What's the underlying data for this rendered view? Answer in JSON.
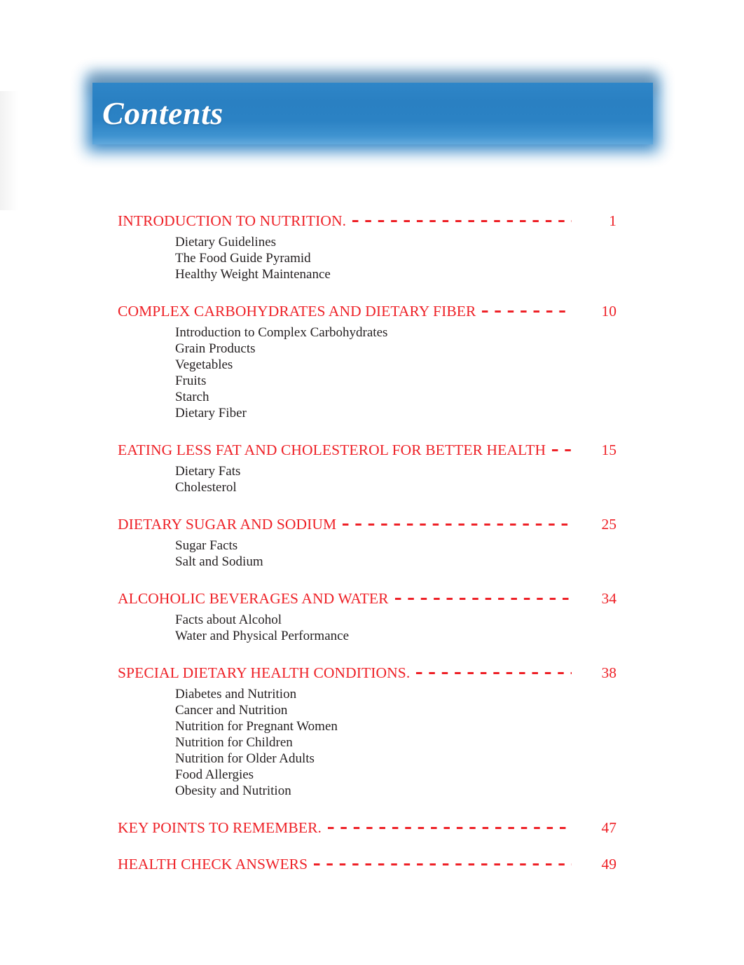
{
  "document": {
    "banner_title": "Contents",
    "banner_color": "#2a80c2",
    "heading_color": "#ee2026",
    "body_text_color": "#231f20"
  },
  "toc": {
    "entries": [
      {
        "title": "INTRODUCTION TO NUTRITION.",
        "page": "1",
        "subsections": [
          "Dietary Guidelines",
          "The Food Guide Pyramid",
          "Healthy Weight Maintenance"
        ]
      },
      {
        "title": "COMPLEX CARBOHYDRATES AND DIETARY FIBER",
        "page": "10",
        "subsections": [
          "Introduction to Complex Carbohydrates",
          "Grain Products",
          "Vegetables",
          "Fruits",
          "Starch",
          "Dietary Fiber"
        ]
      },
      {
        "title": "EATING LESS FAT AND CHOLESTEROL FOR BETTER HEALTH",
        "page": "15",
        "subsections": [
          "Dietary Fats",
          "Cholesterol"
        ]
      },
      {
        "title": "DIETARY SUGAR AND SODIUM",
        "page": "25",
        "subsections": [
          "Sugar Facts",
          "Salt and Sodium"
        ]
      },
      {
        "title": "ALCOHOLIC BEVERAGES AND WATER",
        "page": "34",
        "subsections": [
          "Facts about Alcohol",
          "Water and Physical Performance"
        ]
      },
      {
        "title": "SPECIAL DIETARY HEALTH CONDITIONS.",
        "page": "38",
        "subsections": [
          "Diabetes and Nutrition",
          "Cancer and Nutrition",
          "Nutrition for Pregnant Women",
          "Nutrition for Children",
          "Nutrition for Older Adults",
          "Food Allergies",
          "Obesity and Nutrition"
        ]
      },
      {
        "title": "KEY POINTS TO REMEMBER.",
        "page": "47",
        "subsections": []
      },
      {
        "title": "HEALTH CHECK ANSWERS",
        "page": "49",
        "subsections": []
      }
    ]
  }
}
